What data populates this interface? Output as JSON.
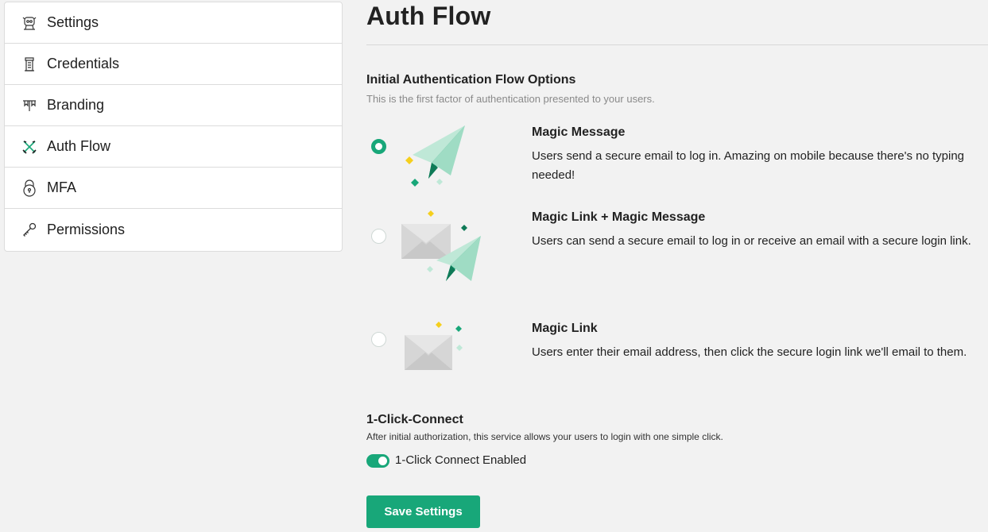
{
  "sidebar": {
    "items": [
      {
        "label": "Settings",
        "icon": "settings-icon"
      },
      {
        "label": "Credentials",
        "icon": "credentials-tower-icon"
      },
      {
        "label": "Branding",
        "icon": "branding-banner-icon"
      },
      {
        "label": "Auth Flow",
        "icon": "crossed-swords-icon"
      },
      {
        "label": "MFA",
        "icon": "padlock-icon"
      },
      {
        "label": "Permissions",
        "icon": "key-icon"
      }
    ]
  },
  "main": {
    "title": "Auth Flow",
    "initial_flow": {
      "title": "Initial Authentication Flow Options",
      "subtitle": "This is the first factor of authentication presented to your users.",
      "options": [
        {
          "title": "Magic Message",
          "description": "Users send a secure email to log in. Amazing on mobile because there's no typing needed!",
          "selected": true,
          "illustration": "paper-plane-icon"
        },
        {
          "title": "Magic Link + Magic Message",
          "description": "Users can send a secure email to log in or receive an email with a secure login link.",
          "selected": false,
          "illustration": "envelope-and-paper-plane-icon"
        },
        {
          "title": "Magic Link",
          "description": "Users enter their email address, then click the secure login link we'll email to them.",
          "selected": false,
          "illustration": "envelope-icon"
        }
      ]
    },
    "one_click": {
      "title": "1-Click-Connect",
      "subtitle": "After initial authorization, this service allows your users to login with one simple click.",
      "toggle_label": "1-Click Connect Enabled",
      "enabled": true
    },
    "save_label": "Save Settings"
  },
  "colors": {
    "accent": "#18a779",
    "accent_light": "#bfe8d7",
    "star_yellow": "#f5cf1d",
    "envelope_gray": "#d6d6d6"
  }
}
